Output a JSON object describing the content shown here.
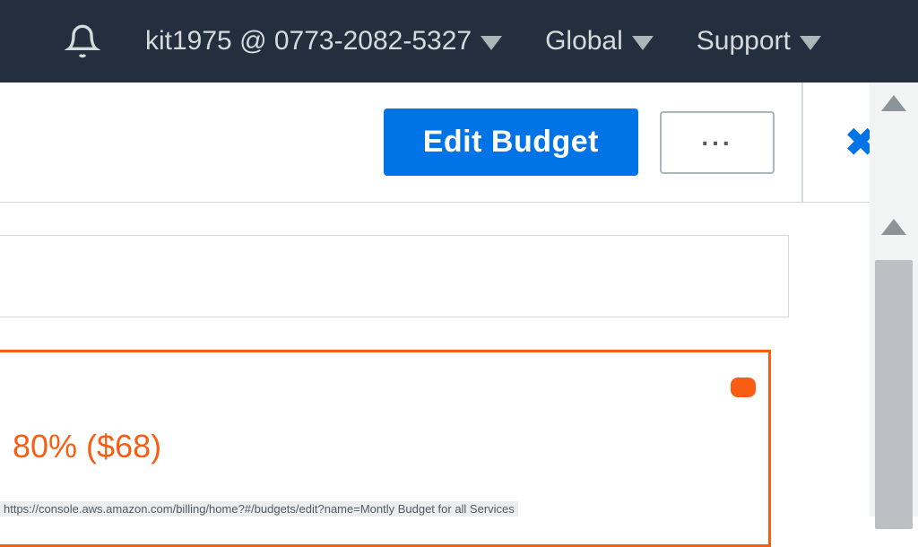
{
  "header": {
    "account_label": "kit1975 @ 0773-2082-5327",
    "region_label": "Global",
    "support_label": "Support"
  },
  "toolbar": {
    "edit_label": "Edit Budget",
    "more_label": "..."
  },
  "alert": {
    "text": "80% ($68)"
  },
  "status_url": "https://console.aws.amazon.com/billing/home?#/budgets/edit?name=Montly Budget for all Services"
}
